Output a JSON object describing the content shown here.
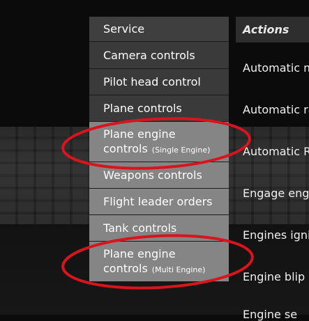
{
  "menu": {
    "items": [
      {
        "label": "Service"
      },
      {
        "label": "Camera controls"
      },
      {
        "label": "Pilot head control"
      },
      {
        "label": "Plane controls"
      },
      {
        "label_line1": "Plane engine",
        "label_line2": "controls",
        "note": "(Single Engine)"
      },
      {
        "label": "Weapons controls"
      },
      {
        "label": "Flight leader orders"
      },
      {
        "label": "Tank controls"
      },
      {
        "label_line1": "Plane engine",
        "label_line2": "controls",
        "note": "(Multi Engine)"
      }
    ]
  },
  "actions": {
    "header": "Actions",
    "rows": [
      {
        "label": "Automatic m"
      },
      {
        "label": "Automatic ra"
      },
      {
        "label": "Automatic R"
      },
      {
        "label": "Engage engi"
      },
      {
        "label": "Engines igniti"
      },
      {
        "label": "Engine blip s"
      },
      {
        "label": "Engine se"
      }
    ]
  },
  "colors": {
    "menu_bg": "#3a3a3a",
    "menu_highlight_bg": "#858585",
    "annotation_red": "#d8141c"
  }
}
